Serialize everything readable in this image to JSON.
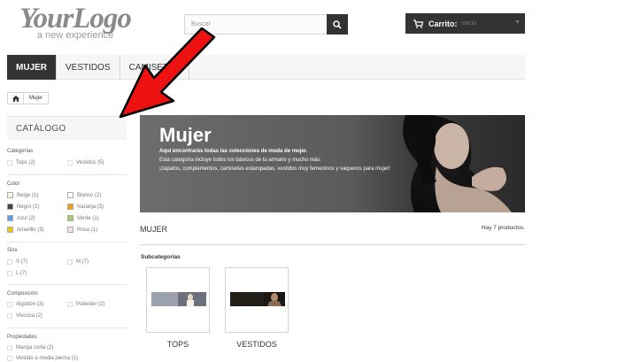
{
  "header": {
    "logo_main": "YourLogo",
    "logo_sub": "a new experience",
    "search_placeholder": "Buscar",
    "cart_label": "Carrito:",
    "cart_value": "vacío"
  },
  "menu": {
    "items": [
      {
        "label": "MUJER",
        "active": true
      },
      {
        "label": "VESTIDOS",
        "active": false
      },
      {
        "label": "CAMISETAS",
        "active": false
      }
    ]
  },
  "breadcrumb": {
    "home_icon": "home-icon",
    "current": "Mujer"
  },
  "sidebar": {
    "title": "CATÁLOGO",
    "categorias": {
      "title": "Categorías",
      "options": [
        "Tops (2)",
        "Vestidos (5)"
      ]
    },
    "color": {
      "title": "Color",
      "options": [
        {
          "label": "Beige (1)",
          "color": "#f5f5dc"
        },
        {
          "label": "Blanco (2)",
          "color": "#ffffff"
        },
        {
          "label": "Negro (2)",
          "color": "#434343"
        },
        {
          "label": "Naranja (3)",
          "color": "#f39c11"
        },
        {
          "label": "Azul (2)",
          "color": "#5d9cec"
        },
        {
          "label": "Verde (1)",
          "color": "#a0d468"
        },
        {
          "label": "Amarillo (3)",
          "color": "#f1c40f"
        },
        {
          "label": "Rosa (1)",
          "color": "#fcdfe0"
        }
      ]
    },
    "size": {
      "title": "Size",
      "options": [
        "S (7)",
        "M (7)",
        "L (7)"
      ]
    },
    "composicion": {
      "title": "Composición",
      "options": [
        "Algodón (3)",
        "Poliester (2)",
        "Viscosa (2)"
      ]
    },
    "propiedades": {
      "title": "Propiedades",
      "options": [
        "Manga corta (2)",
        "Vestido a media pierna (1)"
      ]
    }
  },
  "banner": {
    "title": "Mujer",
    "text_bold": "Aquí encontrarás todas las colecciones de moda de mujer.",
    "text_line2": "Esta categoría incluye todos los básicos de tu armario y mucho más:",
    "text_line3": "¡zapatos, complementos, camisetas estampadas, vestidos muy femeninos y vaqueros para mujer!"
  },
  "main": {
    "category_title": "MUJER",
    "product_count": "Hay 7 productos.",
    "subcategories_label": "Subcategorías",
    "subcategories": [
      {
        "name": "TOPS"
      },
      {
        "name": "VESTIDOS"
      }
    ]
  },
  "annotation": {
    "arrow_color": "#ee1111"
  }
}
